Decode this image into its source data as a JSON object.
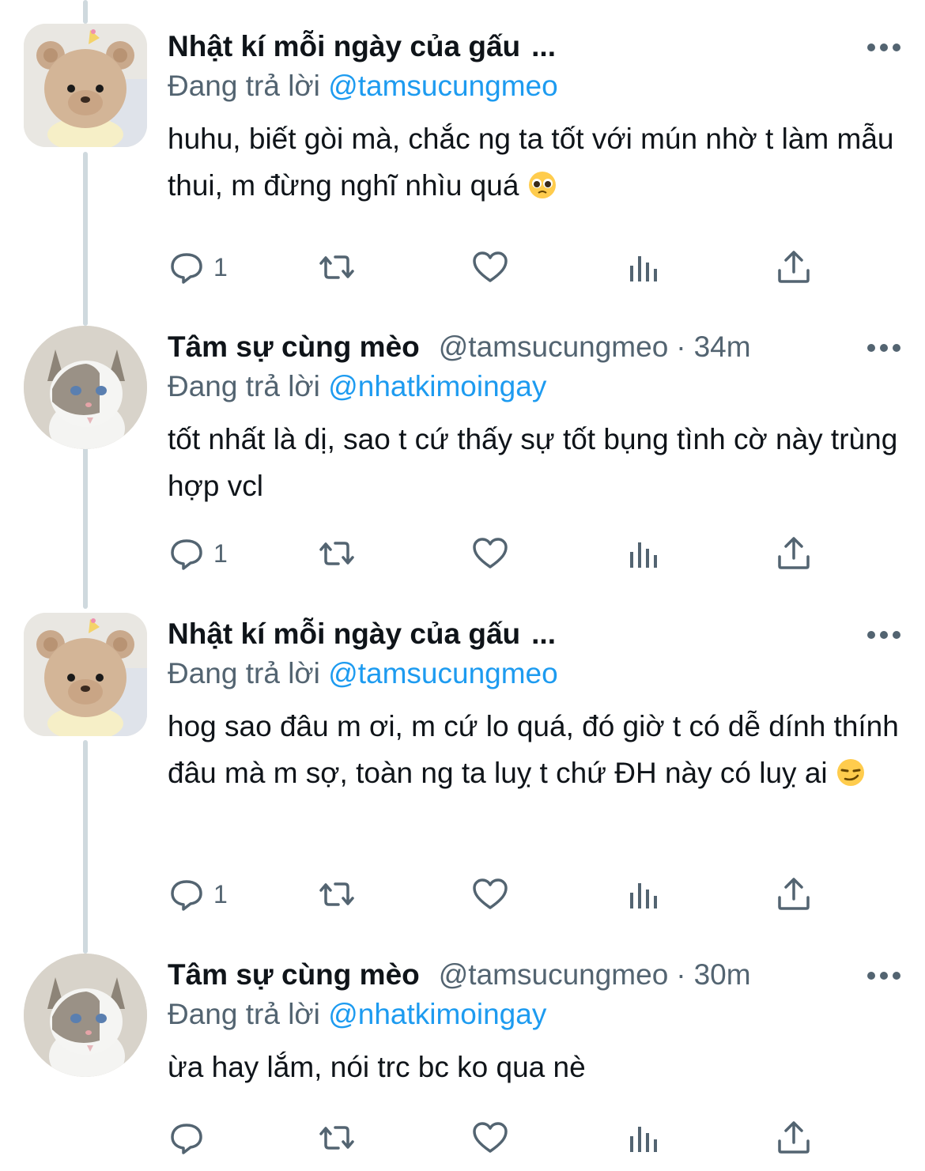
{
  "colors": {
    "accent": "#1d9bf0",
    "muted": "#536471",
    "text": "#0f1419",
    "thread": "#cfd9de"
  },
  "tweets": [
    {
      "name": "Nhật kí mỗi ngày của gấu",
      "name_suffix": "...",
      "reply_prefix": "Đang trả lời",
      "reply_handle": "@tamsucungmeo",
      "text": "huhu, biết gòi mà, chắc ng ta tốt với mún nhờ t làm mẫu thui, m đừng nghĩ nhìu quá",
      "emoji": "pleading-face",
      "reply_count": "1"
    },
    {
      "name": "Tâm sự cùng mèo",
      "handle": "@tamsucungmeo",
      "dot": "·",
      "time": "34m",
      "reply_prefix": "Đang trả lời",
      "reply_handle": "@nhatkimoingay",
      "text": "tốt nhất là dị, sao t cứ thấy sự tốt bụng tình cờ này trùng hợp vcl",
      "reply_count": "1"
    },
    {
      "name": "Nhật kí mỗi ngày của gấu",
      "name_suffix": "...",
      "reply_prefix": "Đang trả lời",
      "reply_handle": "@tamsucungmeo",
      "text": "hog sao đâu m ơi, m cứ lo quá, đó giờ t có dễ dính thính đâu mà m sợ, toàn ng ta luỵ t chứ ĐH này có luỵ ai",
      "emoji": "smirking-face",
      "reply_count": "1"
    },
    {
      "name": "Tâm sự cùng mèo",
      "handle": "@tamsucungmeo",
      "dot": "·",
      "time": "30m",
      "reply_prefix": "Đang trả lời",
      "reply_handle": "@nhatkimoingay",
      "text": "ừa hay lắm, nói trc bc ko qua nè",
      "reply_count": ""
    }
  ],
  "icons": {
    "reply": "reply-bubble-icon",
    "retweet": "retweet-icon",
    "like": "heart-icon",
    "views": "views-bars-icon",
    "share": "share-upload-icon",
    "more": "more-dots-icon"
  }
}
